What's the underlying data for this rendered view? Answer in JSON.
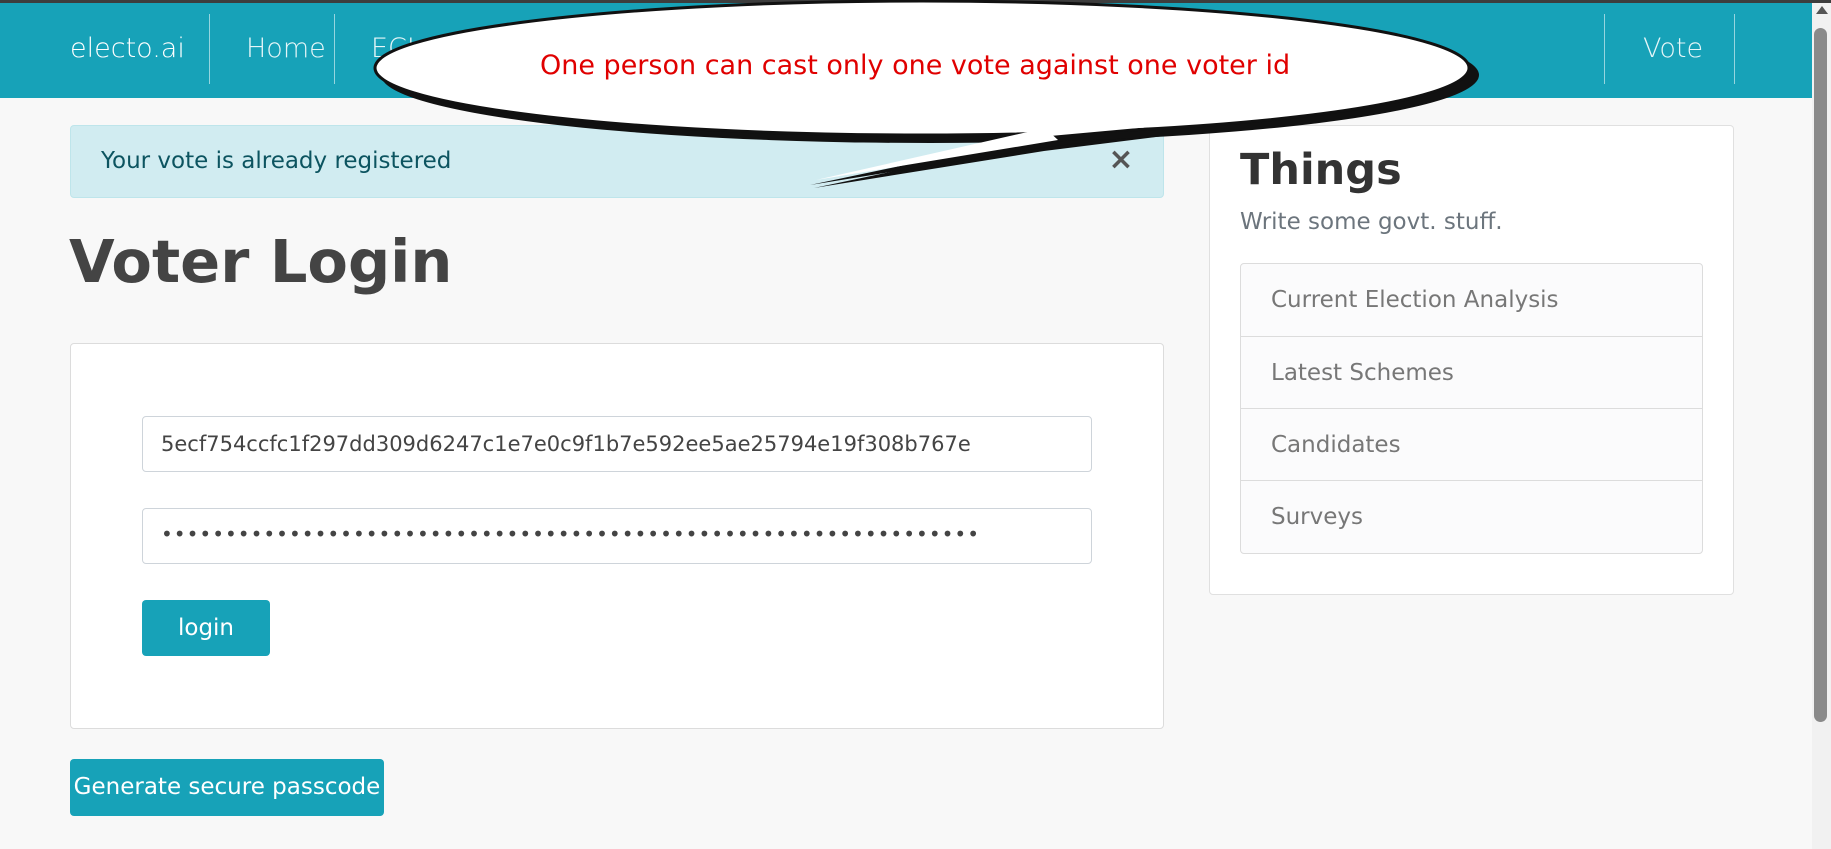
{
  "navbar": {
    "brand": "electo.ai",
    "home": "Home",
    "eci": "ECI",
    "vote": "Vote"
  },
  "callout": {
    "text": "One person can cast only one vote against one voter id"
  },
  "alert": {
    "message": "Your vote is already registered",
    "close_glyph": "×"
  },
  "main": {
    "title": "Voter Login",
    "voter_id_value": "5ecf754ccfc1f297dd309d6247c1e7e0c9f1b7e592ee5ae25794e19f308b767e",
    "passcode_masked": "••••••••••••••••••••••••••••••••••••••••••••••••••••••••••••••••",
    "login_label": "login",
    "generate_label": "Generate secure passcode"
  },
  "sidebar": {
    "title": "Things",
    "subtitle": "Write some govt. stuff.",
    "items": [
      {
        "label": "Current Election Analysis"
      },
      {
        "label": "Latest Schemes"
      },
      {
        "label": "Candidates"
      },
      {
        "label": "Surveys"
      }
    ]
  },
  "colors": {
    "accent": "#17a2b8",
    "alert_bg": "#d1ecf1",
    "alert_text": "#0c5460",
    "callout_text": "#e00000"
  }
}
